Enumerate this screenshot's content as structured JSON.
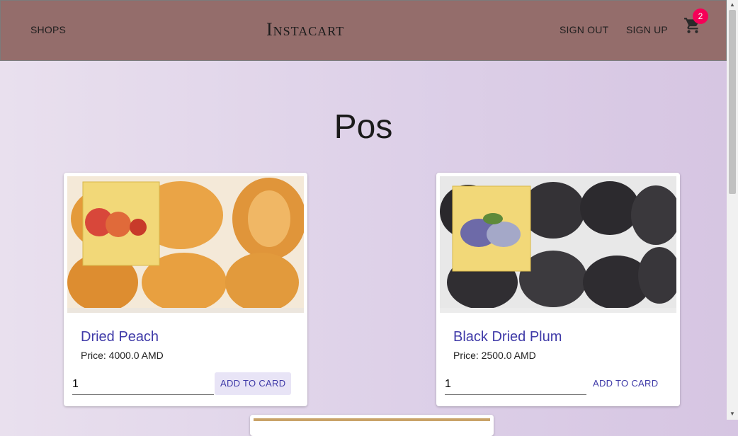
{
  "header": {
    "shops_label": "SHOPS",
    "brand": "Instacart",
    "signout_label": "SIGN OUT",
    "signup_label": "SIGN UP",
    "cart_count": "2",
    "cart_icon": "shopping-cart-icon"
  },
  "page": {
    "title": "Pos"
  },
  "products": [
    {
      "name": "Dried Peach",
      "price": "Price: 4000.0 AMD",
      "quantity": "1",
      "button_label": "ADD TO CARD"
    },
    {
      "name": "Black Dried Plum",
      "price": "Price: 2500.0 AMD",
      "quantity": "1",
      "button_label": "ADD TO CARD"
    }
  ],
  "colors": {
    "header_bg": "#946d6b",
    "accent": "#3f3aa8",
    "badge": "#f50057"
  }
}
